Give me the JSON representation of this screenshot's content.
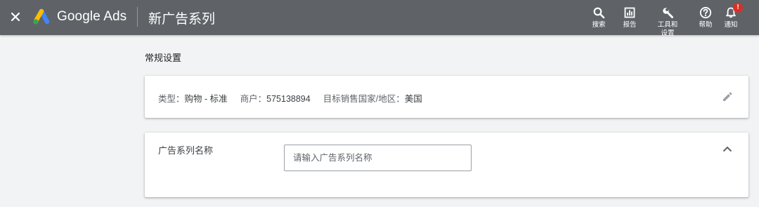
{
  "header": {
    "brand": "Google Ads",
    "title": "新广告系列",
    "tools": [
      {
        "label": "搜索",
        "icon": "search-icon"
      },
      {
        "label": "报告",
        "icon": "reports-icon"
      },
      {
        "label": "工具和设置",
        "icon": "wrench-icon"
      },
      {
        "label": "帮助",
        "icon": "help-icon"
      },
      {
        "label": "通知",
        "icon": "bell-icon",
        "badge": "!"
      }
    ]
  },
  "colors": {
    "topbar": "#5f6368",
    "page_bg": "#f1f3f4",
    "badge": "#d93025",
    "logo_blue": "#4285f4",
    "logo_yellow": "#fbbc04",
    "logo_green": "#34a853"
  },
  "settings": {
    "section_title": "常规设置",
    "summary": {
      "type_label": "类型：",
      "type_value": "购物 - 标准",
      "merchant_label": "商户：",
      "merchant_value": "575138894",
      "country_label": "目标销售国家/地区：",
      "country_value": "美国"
    },
    "campaign_name": {
      "label": "广告系列名称",
      "placeholder": "请输入广告系列名称",
      "value": ""
    }
  }
}
